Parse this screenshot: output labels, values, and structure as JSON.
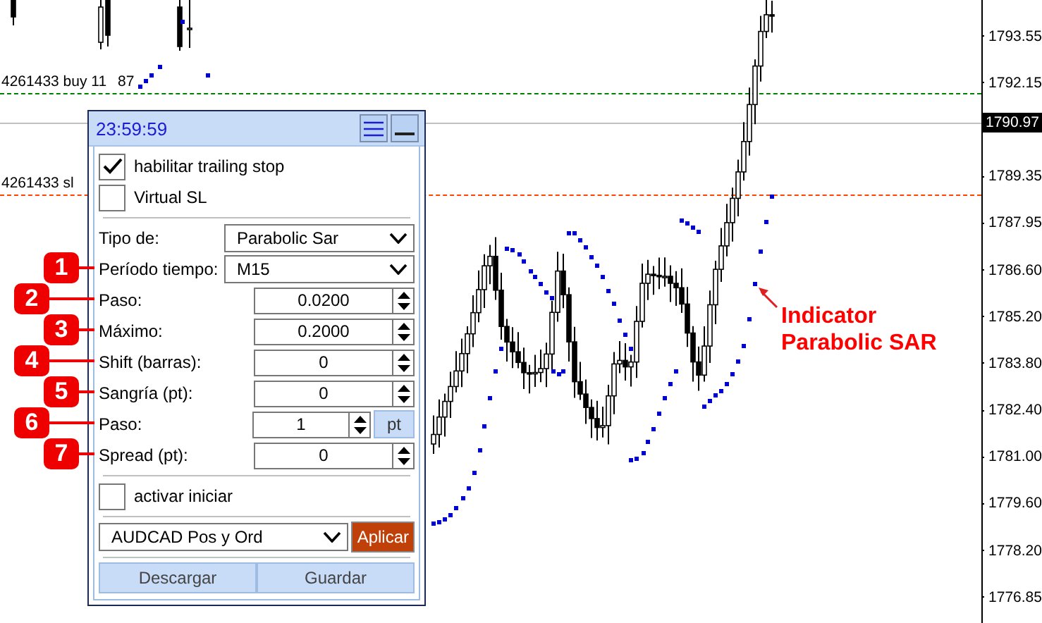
{
  "chart": {
    "order_lines": [
      {
        "kind": "buy",
        "label": "4261433 buy 11",
        "label_tail": "87",
        "color": "#008000"
      },
      {
        "kind": "sl",
        "label": "4261433 sl",
        "color": "#ff4500"
      }
    ],
    "price_axis": [
      "1793.55",
      "1792.15",
      "1789.35",
      "1787.95",
      "1786.60",
      "1785.20",
      "1783.80",
      "1782.40",
      "1781.00",
      "1779.60",
      "1778.20",
      "1776.85"
    ],
    "current_price": "1790.97",
    "annotation": [
      "Indicator",
      "Parabolic SAR"
    ]
  },
  "panel": {
    "time": "23:59:59",
    "checkboxes": [
      {
        "label": "habilitar trailing stop",
        "checked": true
      },
      {
        "label": "Virtual SL",
        "checked": false
      }
    ],
    "fields": [
      {
        "kind": "dropdown",
        "label": "Tipo de:",
        "value": "Parabolic Sar"
      },
      {
        "kind": "dropdown",
        "label": "Período tiempo:",
        "value": "M15",
        "marker": "1"
      },
      {
        "kind": "spin",
        "label": "Paso:",
        "value": "0.0200",
        "marker": "2"
      },
      {
        "kind": "spin",
        "label": "Máximo:",
        "value": "0.2000",
        "marker": "3"
      },
      {
        "kind": "spin",
        "label": "Shift (barras):",
        "value": "0",
        "marker": "4"
      },
      {
        "kind": "spin",
        "label": "Sangría (pt):",
        "value": "0",
        "marker": "5"
      },
      {
        "kind": "spin_unit",
        "label": "Paso:",
        "value": "1",
        "unit": "pt",
        "marker": "6"
      },
      {
        "kind": "spin",
        "label": "Spread (pt):",
        "value": "0",
        "marker": "7"
      }
    ],
    "start_checkbox": {
      "label": "activar iniciar",
      "checked": false
    },
    "preset": "AUDCAD Pos y Ord",
    "apply": "Aplicar",
    "buttons": [
      "Descargar",
      "Guardar"
    ]
  }
}
